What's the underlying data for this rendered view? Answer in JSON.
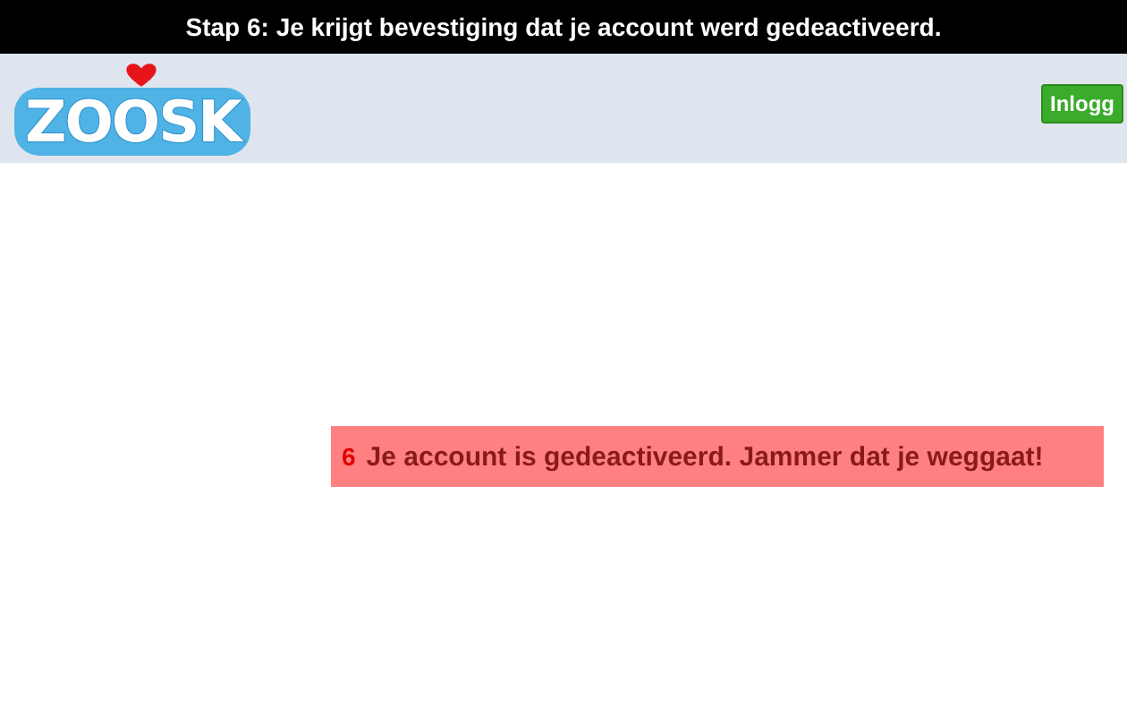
{
  "caption": "Stap 6: Je krijgt bevestiging dat je account werd gedeactiveerd.",
  "header": {
    "logo": "ZOOSK",
    "login_button": "Inlogg"
  },
  "message": {
    "step": "6",
    "text": "Je account is gedeactiveerd. Jammer dat je weggaat!"
  }
}
